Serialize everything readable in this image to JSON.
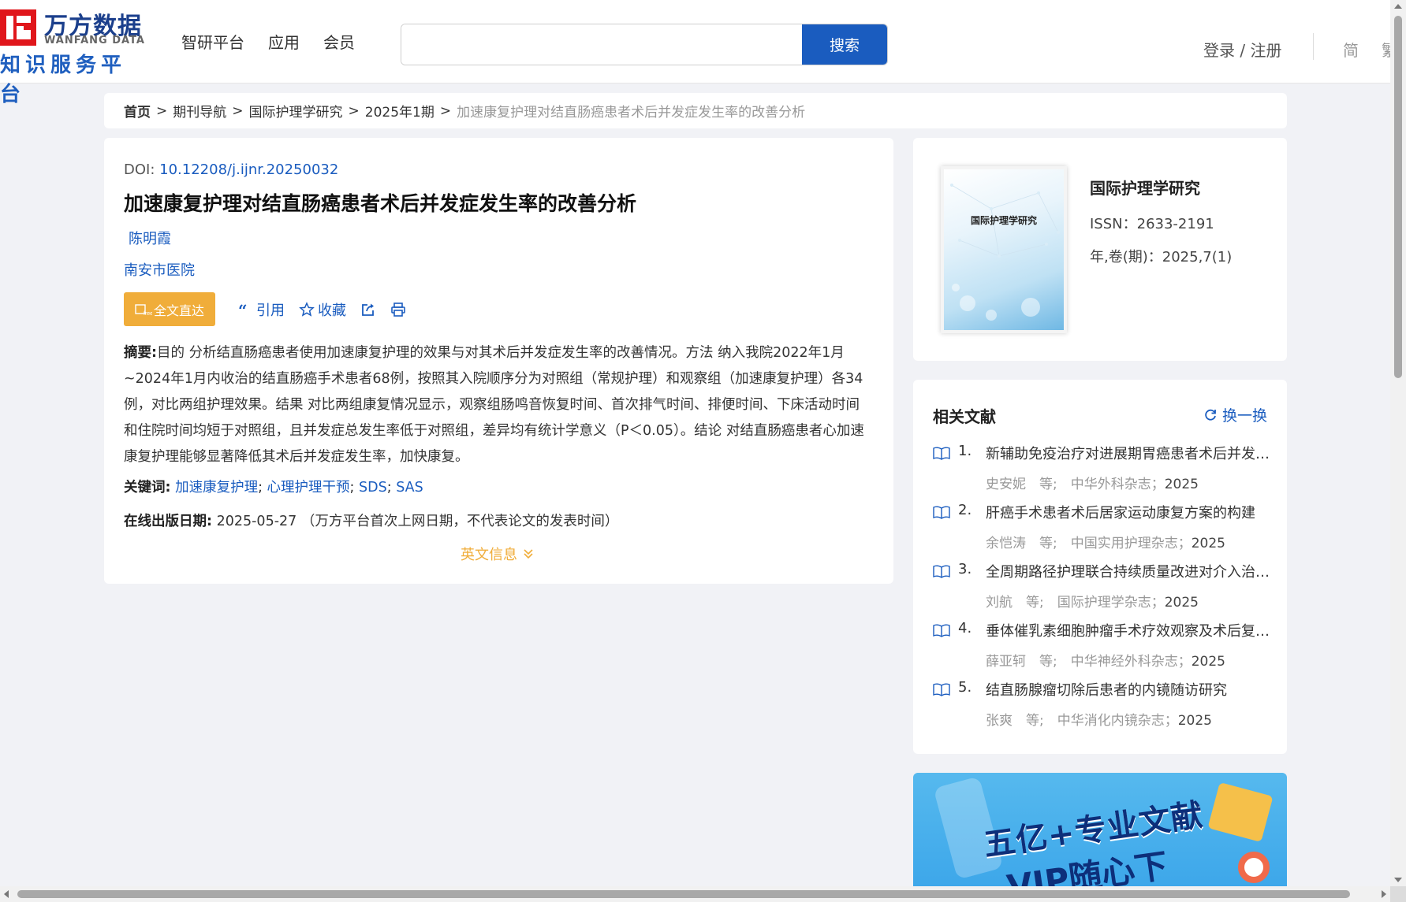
{
  "header": {
    "logo_cn": "万方数据",
    "logo_en": "WANFANG DATA",
    "logo_sub": "知识服务平台",
    "nav": [
      "智研平台",
      "应用",
      "会员"
    ],
    "search_placeholder": "",
    "search_button": "搜索",
    "login": "登录 / 注册",
    "lang_simplified": "简",
    "lang_traditional": "繁"
  },
  "breadcrumb": {
    "home": "首页",
    "items": [
      "期刊导航",
      "国际护理学研究",
      "2025年1期"
    ],
    "current": "加速康复护理对结直肠癌患者术后并发症发生率的改善分析",
    "separator": ">"
  },
  "article": {
    "doi_label": "DOI:",
    "doi": "10.12208/j.ijnr.20250032",
    "title": "加速康复护理对结直肠癌患者术后并发症发生率的改善分析",
    "author": "陈明霞",
    "organization": "南安市医院",
    "full_text_button": "全文直达",
    "cite": "引用",
    "collect": "收藏",
    "abstract_label": "摘要:",
    "abstract": "目的 分析结直肠癌患者使用加速康复护理的效果与对其术后并发症发生率的改善情况。方法 纳入我院2022年1月~2024年1月内收治的结直肠癌手术患者68例，按照其入院顺序分为对照组（常规护理）和观察组（加速康复护理）各34例，对比两组护理效果。结果 对比两组康复情况显示，观察组肠鸣音恢复时间、首次排气时间、排便时间、下床活动时间和住院时间均短于对照组，且并发症总发生率低于对照组，差异均有统计学意义（P＜0.05）。结论 对结直肠癌患者心加速康复护理能够显著降低其术后并发症发生率，加快康复。",
    "keywords_label": "关键词:",
    "keywords": [
      "加速康复护理",
      "心理护理干预",
      "SDS",
      "SAS"
    ],
    "online_label": "在线出版日期:",
    "online_date": "2025-05-27",
    "online_note": "（万方平台首次上网日期，不代表论文的发表时间）",
    "english_info": "英文信息"
  },
  "journal": {
    "cover_title": "国际护理学研究",
    "name": "国际护理学研究",
    "issn": "ISSN：2633-2191",
    "volume": "年,卷(期)：2025,7(1)"
  },
  "related": {
    "title": "相关文献",
    "refresh": "换一换",
    "items": [
      {
        "num": "1.",
        "title": "新辅助免疫治疗对进展期胃癌患者术后并发症的影响",
        "authors": "史安妮",
        "etc": "等;",
        "source": "中华外科杂志",
        "year": "2025"
      },
      {
        "num": "2.",
        "title": "肝癌手术患者术后居家运动康复方案的构建",
        "authors": "余恺涛",
        "etc": "等;",
        "source": "中国实用护理杂志",
        "year": "2025"
      },
      {
        "num": "3.",
        "title": "全周期路径护理联合持续质量改进对介入治疗患者的影响",
        "authors": "刘航",
        "etc": "等;",
        "source": "国际护理学杂志",
        "year": "2025"
      },
      {
        "num": "4.",
        "title": "垂体催乳素细胞肿瘤手术疗效观察及术后复发因素分析",
        "authors": "薛亚轲",
        "etc": "等;",
        "source": "中华神经外科杂志",
        "year": "2025"
      },
      {
        "num": "5.",
        "title": "结直肠腺瘤切除后患者的内镜随访研究",
        "authors": "张爽",
        "etc": "等;",
        "source": "中华消化内镜杂志",
        "year": "2025"
      }
    ]
  },
  "banner": {
    "line1": "五亿+专业文献",
    "line2": "VIP随心下"
  },
  "colors": {
    "link": "#1a5cbf",
    "accent": "#f0ad3a",
    "brand_red": "#e0161b"
  }
}
